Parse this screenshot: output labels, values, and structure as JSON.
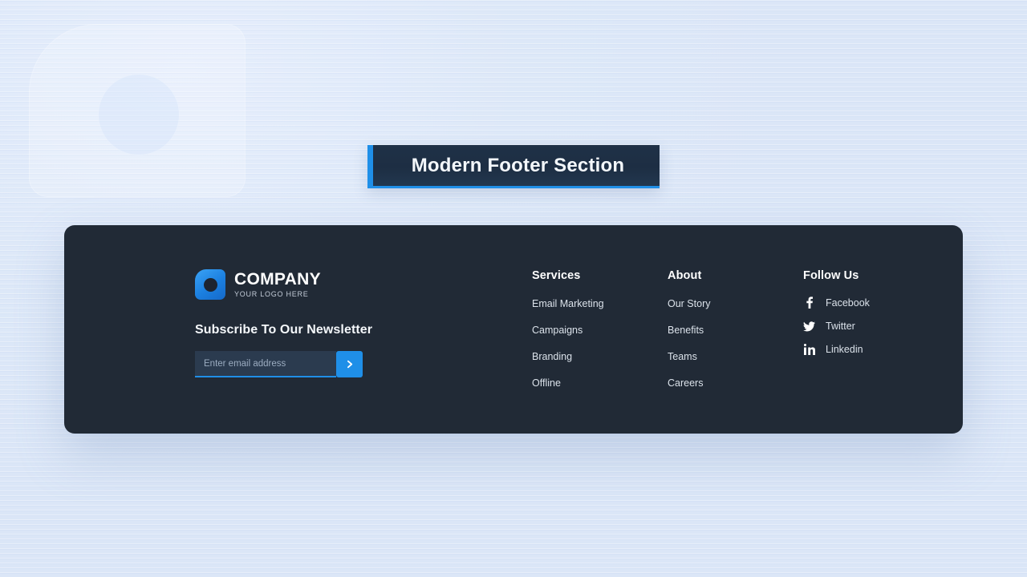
{
  "page": {
    "background_color": "#dfe9f9",
    "watermark_icon": "company-logo-watermark"
  },
  "banner": {
    "title": "Modern Footer Section",
    "accent_color": "#1f8fe8",
    "background_color": "#1d2e43"
  },
  "footer": {
    "background_color": "#212a36",
    "brand": {
      "logo_icon": "company-logo-icon",
      "name": "COMPANY",
      "tagline": "YOUR LOGO HERE",
      "logo_color": "#1b7fe0"
    },
    "newsletter": {
      "title": "Subscribe To Our Newsletter",
      "placeholder": "Enter email address",
      "value": "",
      "submit_icon": "chevron-right-icon",
      "submit_color": "#1f8fe8"
    },
    "columns": [
      {
        "title": "Services",
        "links": [
          {
            "label": "Email Marketing"
          },
          {
            "label": "Campaigns"
          },
          {
            "label": "Branding"
          },
          {
            "label": "Offline"
          }
        ]
      },
      {
        "title": "About",
        "links": [
          {
            "label": "Our Story"
          },
          {
            "label": "Benefits"
          },
          {
            "label": "Teams"
          },
          {
            "label": "Careers"
          }
        ]
      }
    ],
    "follow": {
      "title": "Follow Us",
      "socials": [
        {
          "label": "Facebook",
          "icon": "facebook-icon"
        },
        {
          "label": "Twitter",
          "icon": "twitter-icon"
        },
        {
          "label": "Linkedin",
          "icon": "linkedin-icon"
        }
      ]
    }
  }
}
